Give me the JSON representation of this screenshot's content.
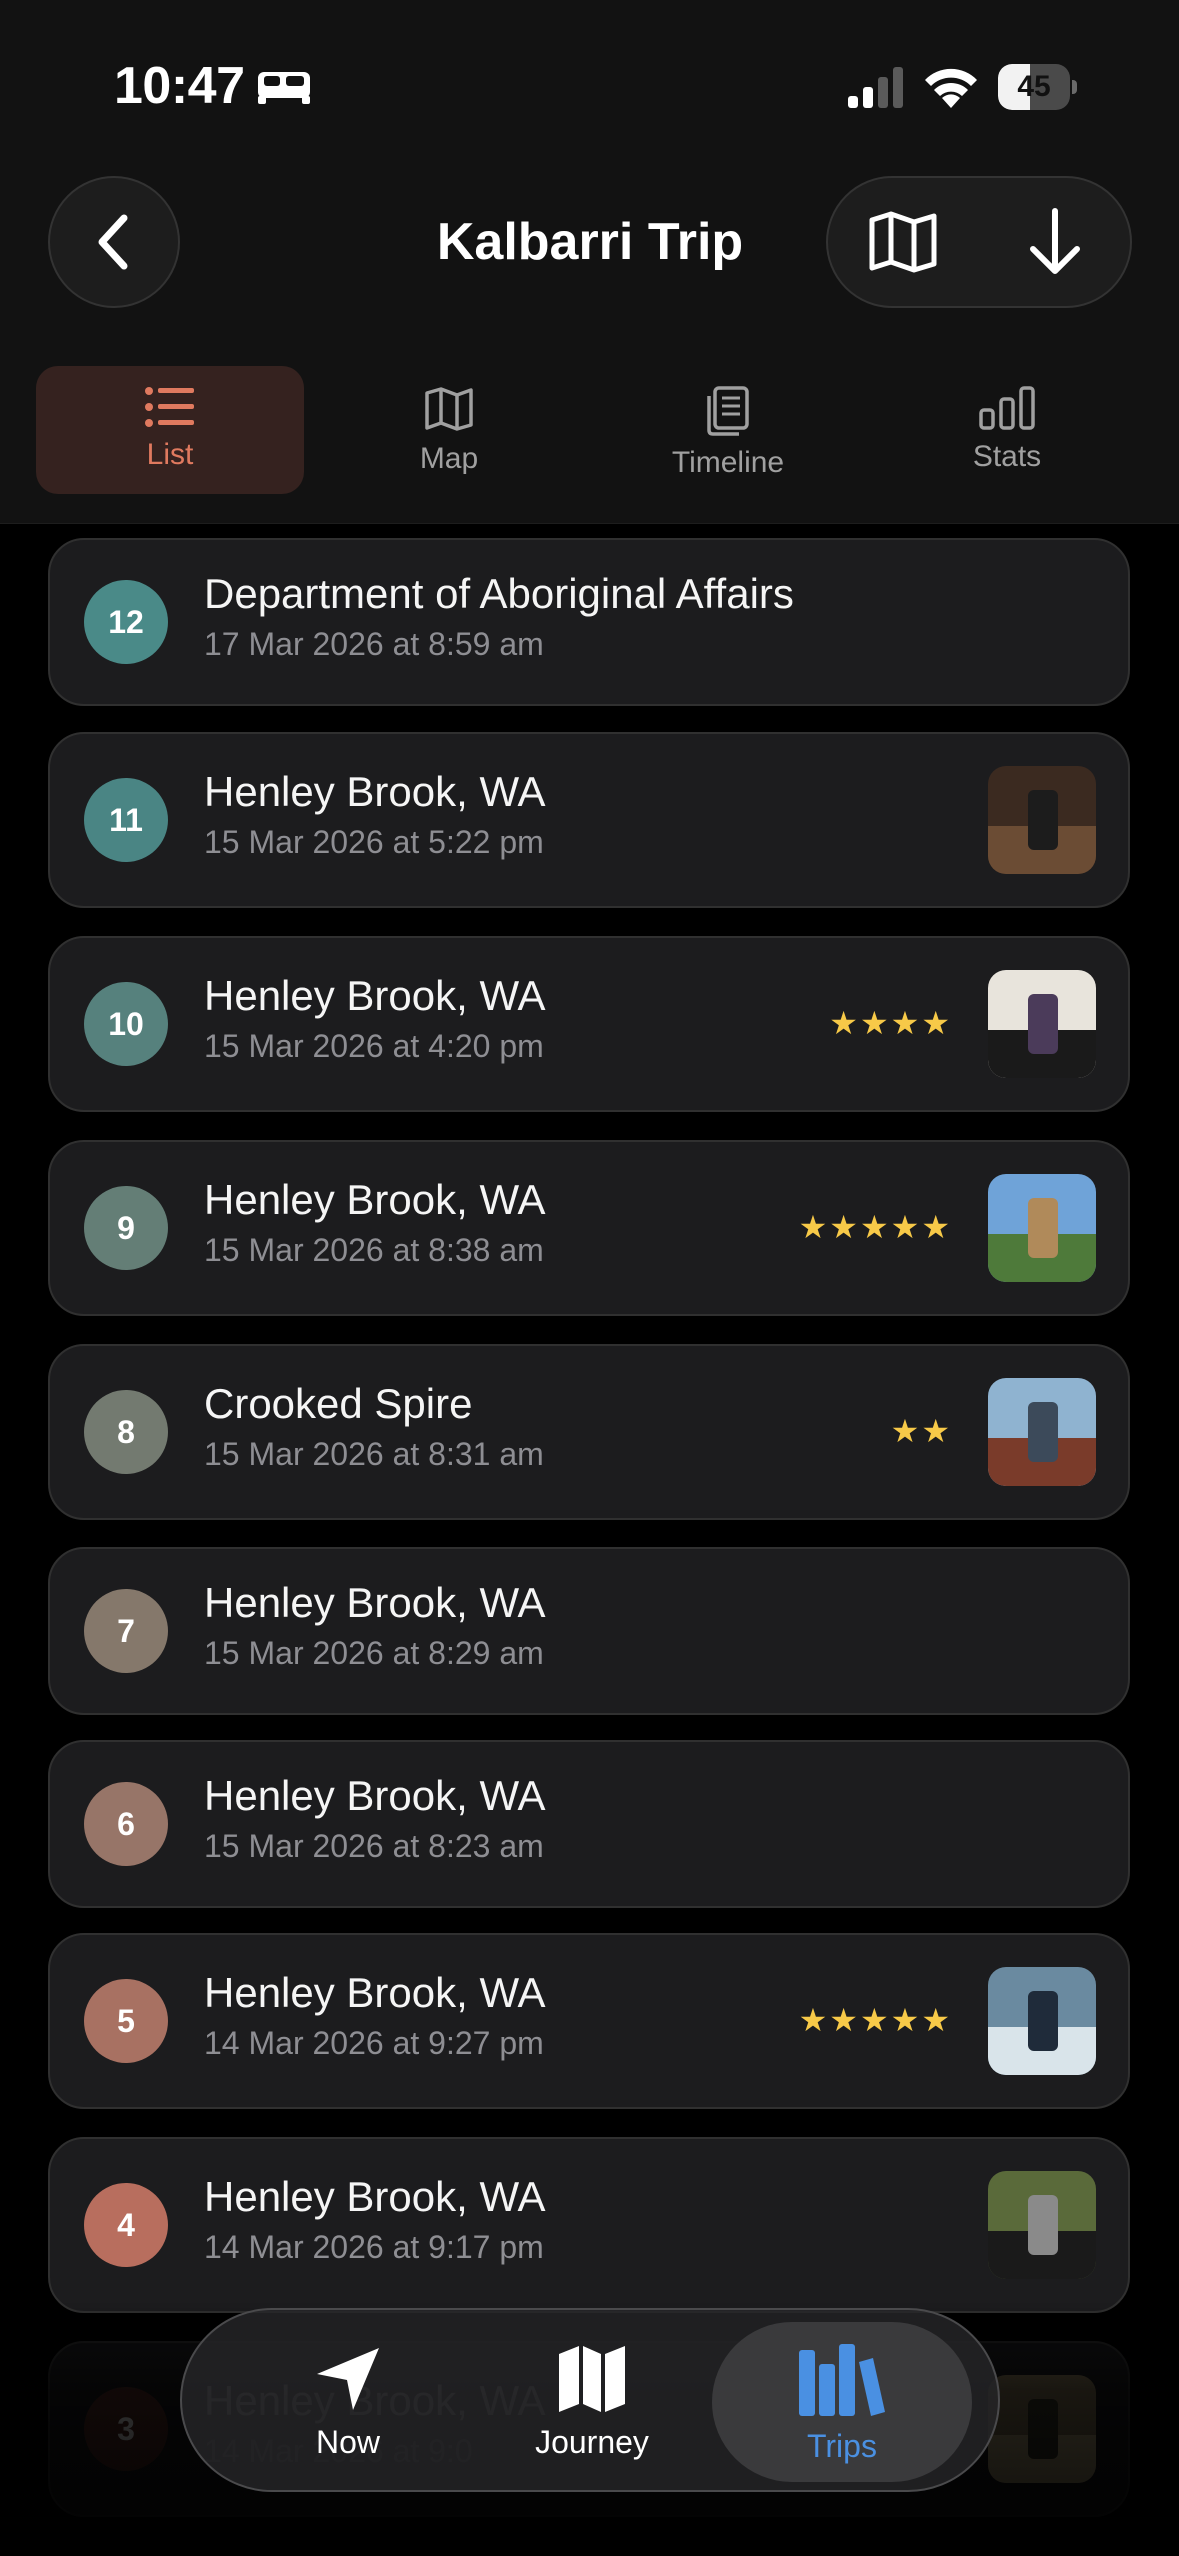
{
  "status_bar": {
    "time": "10:47",
    "battery": "45",
    "battery_level": 0.45
  },
  "header": {
    "title": "Kalbarri Trip"
  },
  "tabs": [
    {
      "label": "List",
      "active": true,
      "icon": "list-icon"
    },
    {
      "label": "Map",
      "active": false,
      "icon": "map-icon"
    },
    {
      "label": "Timeline",
      "active": false,
      "icon": "timeline-icon"
    },
    {
      "label": "Stats",
      "active": false,
      "icon": "stats-icon"
    }
  ],
  "colors": {
    "accent": "#e07a5f",
    "star": "#f7c948",
    "dock_active": "#4a90e2"
  },
  "items": [
    {
      "number": "12",
      "title": "Department of Aboriginal Affairs",
      "subtitle": "17 Mar 2026 at 8:59 am",
      "rating": "",
      "photo": false,
      "color": "#4a8a88"
    },
    {
      "number": "11",
      "title": "Henley Brook, WA",
      "subtitle": "15 Mar 2026 at 5:22 pm",
      "rating": "",
      "photo": true,
      "color": "#4a8584"
    },
    {
      "number": "10",
      "title": "Henley Brook, WA",
      "subtitle": "15 Mar 2026 at 4:20 pm",
      "rating": "★★★★",
      "photo": true,
      "color": "#56817d"
    },
    {
      "number": "9",
      "title": "Henley Brook, WA",
      "subtitle": "15 Mar 2026 at 8:38 am",
      "rating": "★★★★★",
      "photo": true,
      "color": "#647e76"
    },
    {
      "number": "8",
      "title": "Crooked Spire",
      "subtitle": "15 Mar 2026 at 8:31 am",
      "rating": "★★",
      "photo": true,
      "color": "#737a70"
    },
    {
      "number": "7",
      "title": "Henley Brook, WA",
      "subtitle": "15 Mar 2026 at 8:29 am",
      "rating": "",
      "photo": false,
      "color": "#85786b"
    },
    {
      "number": "6",
      "title": "Henley Brook, WA",
      "subtitle": "15 Mar 2026 at 8:23 am",
      "rating": "",
      "photo": false,
      "color": "#977568"
    },
    {
      "number": "5",
      "title": "Henley Brook, WA",
      "subtitle": "14 Mar 2026 at 9:27 pm",
      "rating": "★★★★★",
      "photo": true,
      "color": "#a87162"
    },
    {
      "number": "4",
      "title": "Henley Brook, WA",
      "subtitle": "14 Mar 2026 at 9:17 pm",
      "rating": "",
      "photo": true,
      "color": "#b86e5e"
    },
    {
      "number": "3",
      "title": "Henley Brook, WA",
      "subtitle": "14 Mar 2026 at 9:0",
      "rating": "",
      "photo": true,
      "color": "#5a3028"
    }
  ],
  "dock": [
    {
      "label": "Now",
      "active": false,
      "icon": "location-arrow-icon"
    },
    {
      "label": "Journey",
      "active": false,
      "icon": "journey-map-icon"
    },
    {
      "label": "Trips",
      "active": true,
      "icon": "trips-books-icon"
    }
  ]
}
